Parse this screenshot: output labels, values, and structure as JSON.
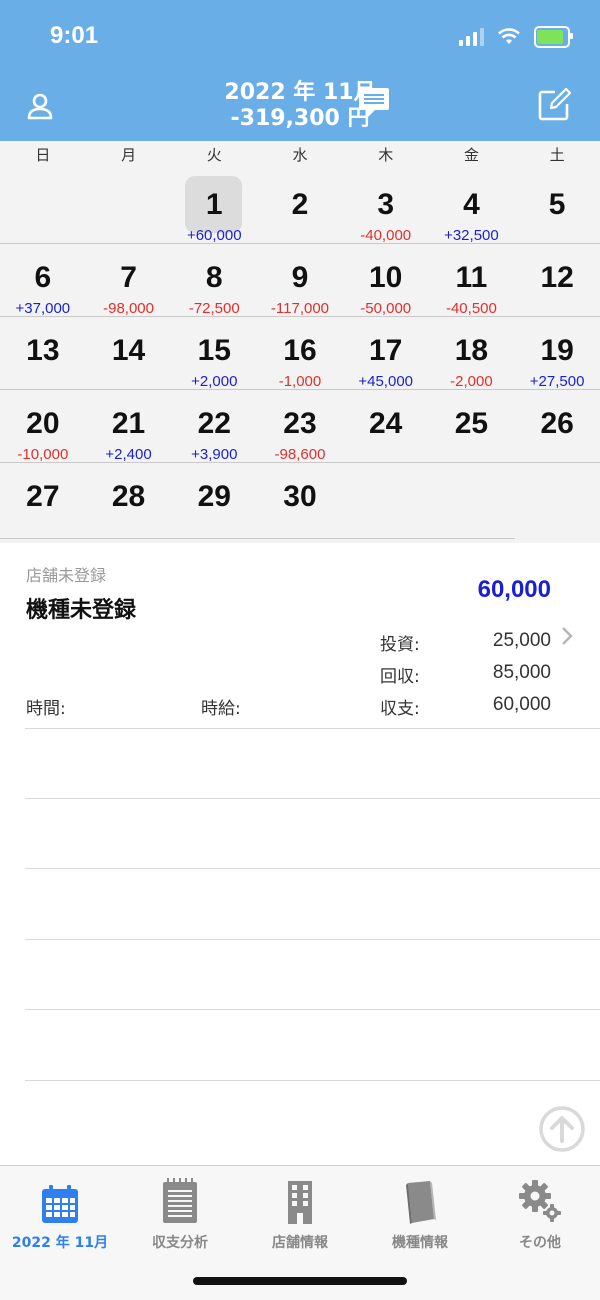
{
  "status": {
    "time": "9:01"
  },
  "header": {
    "year_month": "2022 年 11月",
    "total": "-319,300 円",
    "accent": "#6aaee8"
  },
  "weekdays": [
    "日",
    "月",
    "火",
    "水",
    "木",
    "金",
    "土"
  ],
  "calendar": {
    "selected_day": "1",
    "positive_color": "#1a1fd4",
    "negative_color": "#e0302c",
    "weeks": [
      [
        {
          "day": "",
          "amount": ""
        },
        {
          "day": "",
          "amount": ""
        },
        {
          "day": "1",
          "amount": "+60,000"
        },
        {
          "day": "2",
          "amount": ""
        },
        {
          "day": "3",
          "amount": "-40,000"
        },
        {
          "day": "4",
          "amount": "+32,500"
        },
        {
          "day": "5",
          "amount": ""
        }
      ],
      [
        {
          "day": "6",
          "amount": "+37,000"
        },
        {
          "day": "7",
          "amount": "-98,000"
        },
        {
          "day": "8",
          "amount": "-72,500"
        },
        {
          "day": "9",
          "amount": "-117,000"
        },
        {
          "day": "10",
          "amount": "-50,000"
        },
        {
          "day": "11",
          "amount": "-40,500"
        },
        {
          "day": "12",
          "amount": ""
        }
      ],
      [
        {
          "day": "13",
          "amount": ""
        },
        {
          "day": "14",
          "amount": ""
        },
        {
          "day": "15",
          "amount": "+2,000"
        },
        {
          "day": "16",
          "amount": "-1,000"
        },
        {
          "day": "17",
          "amount": "+45,000"
        },
        {
          "day": "18",
          "amount": "-2,000"
        },
        {
          "day": "19",
          "amount": "+27,500"
        }
      ],
      [
        {
          "day": "20",
          "amount": "-10,000"
        },
        {
          "day": "21",
          "amount": "+2,400"
        },
        {
          "day": "22",
          "amount": "+3,900"
        },
        {
          "day": "23",
          "amount": "-98,600"
        },
        {
          "day": "24",
          "amount": ""
        },
        {
          "day": "25",
          "amount": ""
        },
        {
          "day": "26",
          "amount": ""
        }
      ],
      [
        {
          "day": "27",
          "amount": ""
        },
        {
          "day": "28",
          "amount": ""
        },
        {
          "day": "29",
          "amount": ""
        },
        {
          "day": "30",
          "amount": ""
        },
        {
          "day": "",
          "amount": ""
        },
        {
          "day": "",
          "amount": ""
        },
        {
          "day": "",
          "amount": ""
        }
      ]
    ]
  },
  "entry": {
    "store": "店舗未登録",
    "machine": "機種未登録",
    "total": "60,000",
    "invest_label": "投資:",
    "invest_value": "25,000",
    "recover_label": "回収:",
    "recover_value": "85,000",
    "time_label": "時間:",
    "hourly_label": "時給:",
    "balance_label": "収支:",
    "balance_value": "60,000"
  },
  "tabs": [
    {
      "label": "2022 年 11月",
      "icon": "calendar-icon",
      "active": true
    },
    {
      "label": "収支分析",
      "icon": "notepad-icon",
      "active": false
    },
    {
      "label": "店舗情報",
      "icon": "building-icon",
      "active": false
    },
    {
      "label": "機種情報",
      "icon": "book-icon",
      "active": false
    },
    {
      "label": "その他",
      "icon": "gear-icon",
      "active": false
    }
  ]
}
